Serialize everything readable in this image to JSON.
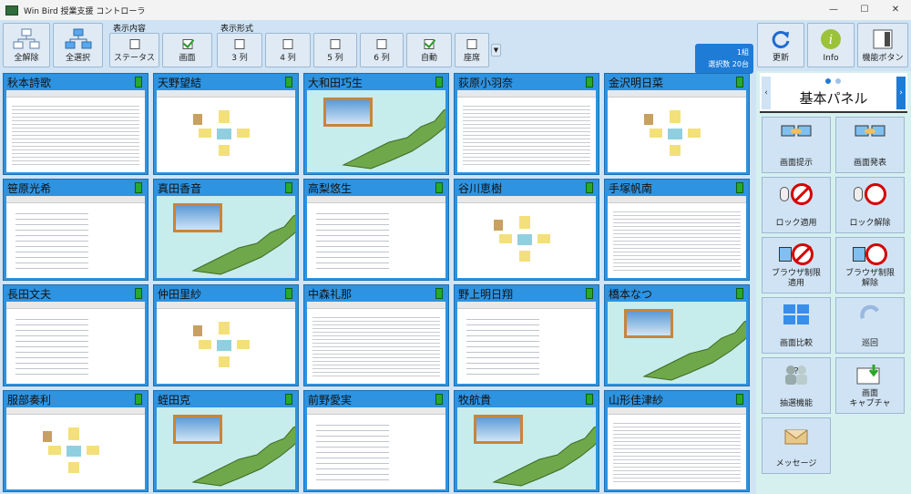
{
  "window": {
    "title": "Win Bird 授業支援 コントローラ",
    "controls": [
      "—",
      "☐",
      "✕"
    ]
  },
  "toolbar": {
    "clear_all": "全解除",
    "select_all": "全選択",
    "display_content_label": "表示内容",
    "status": "ステータス",
    "screen": "画面",
    "display_format_label": "表示形式",
    "col3": "3 列",
    "col4": "4 列",
    "col5": "5 列",
    "col6": "6 列",
    "auto": "自動",
    "seat": "座席",
    "class_name": "1組",
    "selected_count": "選択数 20台",
    "refresh": "更新",
    "info": "Info",
    "function_button": "機能ボタン",
    "checked": {
      "status": false,
      "screen": true,
      "col3": false,
      "col4": false,
      "col5": false,
      "col6": false,
      "auto": true,
      "seat": false
    }
  },
  "students": [
    {
      "name": "秋本詩歌",
      "screen": "table"
    },
    {
      "name": "天野望結",
      "screen": "diagram"
    },
    {
      "name": "大和田巧生",
      "screen": "map"
    },
    {
      "name": "荻原小羽奈",
      "screen": "table"
    },
    {
      "name": "金沢明日菜",
      "screen": "diagram"
    },
    {
      "name": "笹原光希",
      "screen": "text"
    },
    {
      "name": "真田香音",
      "screen": "map"
    },
    {
      "name": "高梨悠生",
      "screen": "text"
    },
    {
      "name": "谷川恵樹",
      "screen": "diagram"
    },
    {
      "name": "手塚帆南",
      "screen": "table"
    },
    {
      "name": "長田文夫",
      "screen": "text"
    },
    {
      "name": "仲田里紗",
      "screen": "diagram"
    },
    {
      "name": "中森礼那",
      "screen": "table"
    },
    {
      "name": "野上明日翔",
      "screen": "text"
    },
    {
      "name": "橋本なつ",
      "screen": "map"
    },
    {
      "name": "服部奏利",
      "screen": "diagram"
    },
    {
      "name": "蛭田克",
      "screen": "map"
    },
    {
      "name": "前野愛実",
      "screen": "text"
    },
    {
      "name": "牧航貴",
      "screen": "map"
    },
    {
      "name": "山形佳津紗",
      "screen": "table"
    }
  ],
  "panel": {
    "title": "基本パネル",
    "buttons": {
      "present": "画面提示",
      "announce": "画面発表",
      "lock_apply": "ロック適用",
      "lock_release": "ロック解除",
      "browser_apply_1": "ブラウザ制限",
      "browser_apply_2": "適用",
      "browser_release_1": "ブラウザ制限",
      "browser_release_2": "解除",
      "compare": "画面比較",
      "patrol": "巡回",
      "lottery": "抽選機能",
      "capture_1": "画面",
      "capture_2": "キャプチャ",
      "message": "メッセージ"
    }
  },
  "colors": {
    "accent": "#1e7bd6",
    "tile": "#2e93e0",
    "panel": "#d5f0ef",
    "battery": "#2aa82a"
  }
}
